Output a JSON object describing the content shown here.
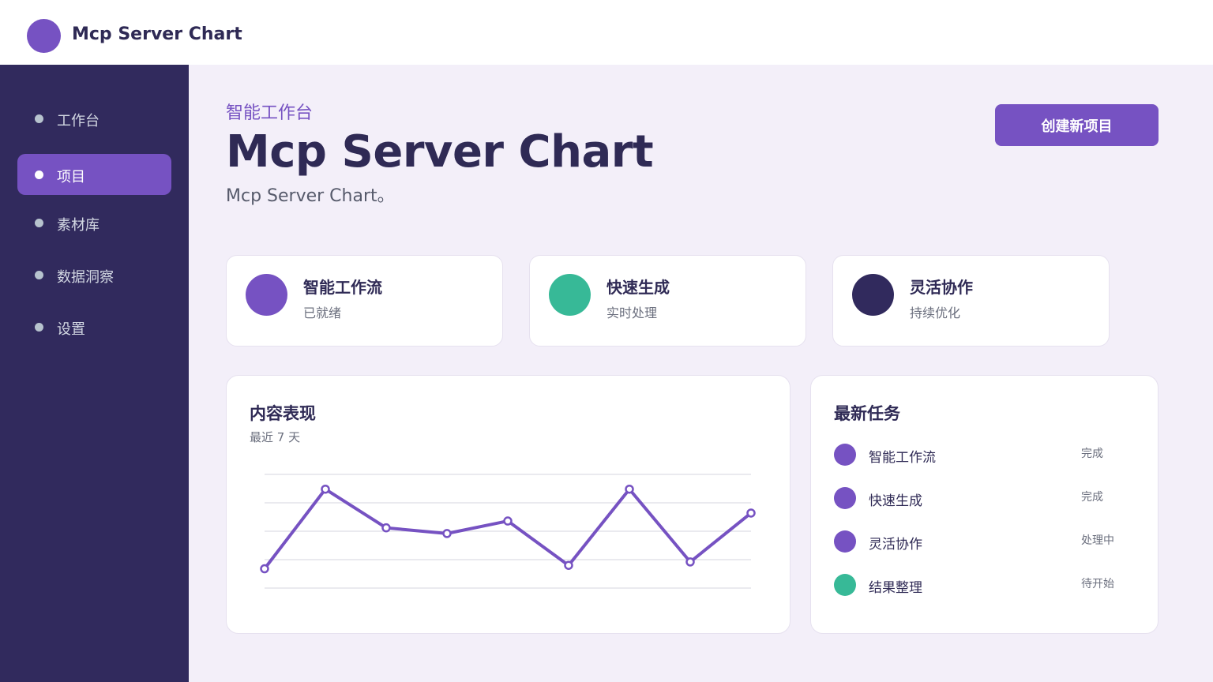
{
  "app": {
    "title": "Mcp Server Chart"
  },
  "colors": {
    "accent": "#7652c2",
    "green": "#37b997",
    "navy": "#312a5d",
    "background": "#f3eff9"
  },
  "sidebar": {
    "items": [
      {
        "label": "工作台",
        "active": false
      },
      {
        "label": "项目",
        "active": true
      },
      {
        "label": "素材库",
        "active": false
      },
      {
        "label": "数据洞察",
        "active": false
      },
      {
        "label": "设置",
        "active": false
      }
    ]
  },
  "header": {
    "eyebrow": "智能工作台",
    "title": "Mcp Server Chart",
    "subtitle": "Mcp Server Chart。",
    "create_button": "创建新项目"
  },
  "stats": [
    {
      "title": "智能工作流",
      "subtitle": "已就绪",
      "color": "#7652c2"
    },
    {
      "title": "快速生成",
      "subtitle": "实时处理",
      "color": "#37b997"
    },
    {
      "title": "灵活协作",
      "subtitle": "持续优化",
      "color": "#312a5d"
    }
  ],
  "performance": {
    "title": "内容表现",
    "subtitle": "最近 7 天"
  },
  "chart_data": {
    "type": "line",
    "title": "内容表现",
    "subtitle": "最近 7 天",
    "xlabel": "",
    "ylabel": "",
    "grid": true,
    "ylim": [
      0,
      100
    ],
    "x": [
      1,
      2,
      3,
      4,
      5,
      6,
      7,
      8,
      9
    ],
    "series": [
      {
        "values": [
          17,
          87,
          53,
          48,
          59,
          20,
          87,
          23,
          66
        ],
        "color": "#7652c2"
      }
    ]
  },
  "tasks": {
    "title": "最新任务",
    "items": [
      {
        "label": "智能工作流",
        "status": "完成",
        "color": "#7652c2"
      },
      {
        "label": "快速生成",
        "status": "完成",
        "color": "#7652c2"
      },
      {
        "label": "灵活协作",
        "status": "处理中",
        "color": "#7652c2"
      },
      {
        "label": "结果整理",
        "status": "待开始",
        "color": "#37b997"
      }
    ]
  }
}
